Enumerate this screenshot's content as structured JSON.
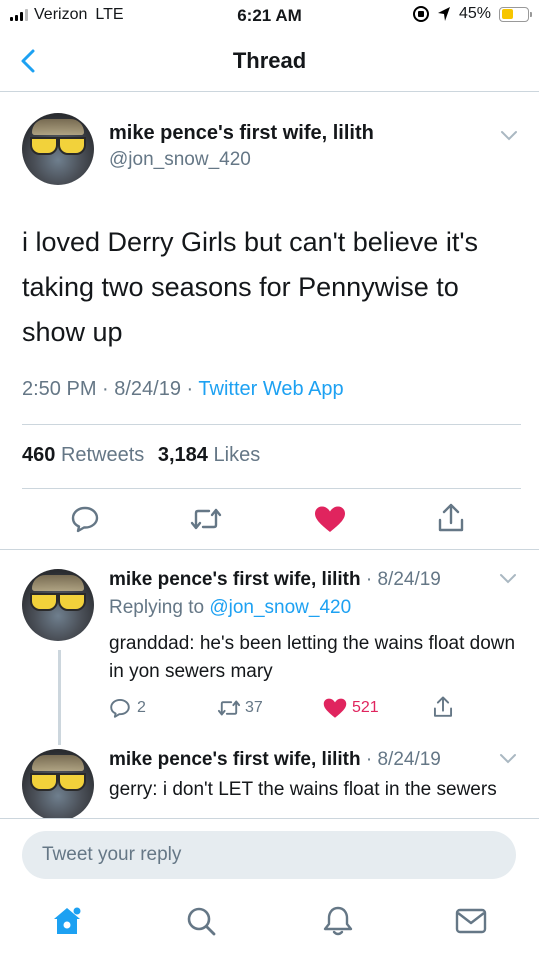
{
  "status": {
    "carrier": "Verizon",
    "network": "LTE",
    "time": "6:21 AM",
    "battery": "45%"
  },
  "nav": {
    "title": "Thread"
  },
  "main_tweet": {
    "name": "mike pence's first wife, lilith",
    "handle": "@jon_snow_420",
    "text": "i loved Derry Girls but can't believe it's taking two seasons for Pennywise to show up",
    "time_date": "2:50 PM · 8/24/19 · ",
    "source": "Twitter Web App",
    "retweets_count": "460",
    "retweets_label": "Retweets",
    "likes_count": "3,184",
    "likes_label": "Likes"
  },
  "replies": [
    {
      "name": "mike pence's first wife, lilith",
      "date": " · 8/24/19",
      "replying_prefix": "Replying to ",
      "replying_handle": "@jon_snow_420",
      "text": "granddad: he's been letting the wains float down in yon sewers mary",
      "reply_count": "2",
      "retweet_count": "37",
      "like_count": "521"
    },
    {
      "name": "mike pence's first wife, lilith",
      "date": " · 8/24/19",
      "text": "gerry: i don't LET the wains float in the sewers"
    }
  ],
  "reply_bar": {
    "placeholder": "Tweet your reply"
  },
  "colors": {
    "accent": "#1da1f2",
    "like": "#e0245e",
    "secondary_text": "#657786",
    "divider": "#ccd6dd"
  },
  "tabs": [
    "home-icon",
    "search-icon",
    "notifications-icon",
    "messages-icon"
  ]
}
